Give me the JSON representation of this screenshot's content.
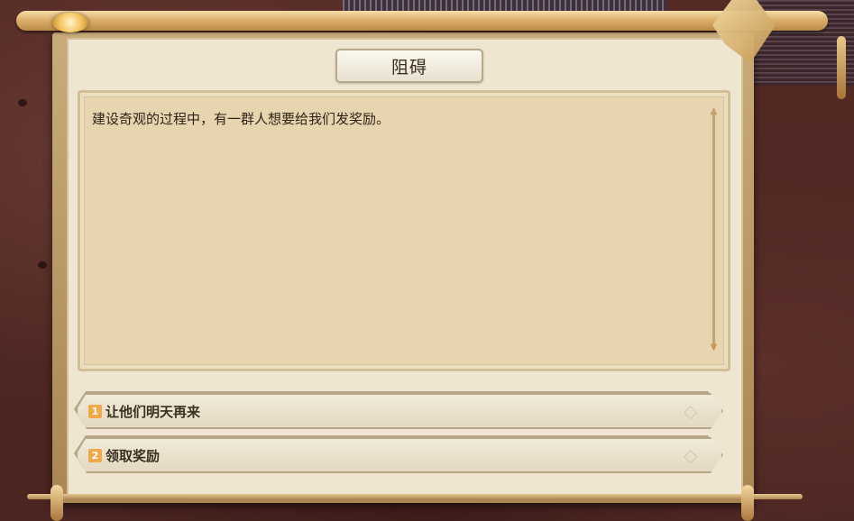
{
  "dialog": {
    "title": "阻碍",
    "message": "建设奇观的过程中，有一群人想要给我们发奖励。"
  },
  "options": [
    {
      "number": "1",
      "label": "让他们明天再来"
    },
    {
      "number": "2",
      "label": "领取奖励"
    }
  ],
  "colors": {
    "panel_bg": "#efe6d2",
    "text_box_bg": "#e6d5ae",
    "option_number_bg": "#f0a84a",
    "frame_gold": "#c9ab7a",
    "background": "#4a2420"
  }
}
